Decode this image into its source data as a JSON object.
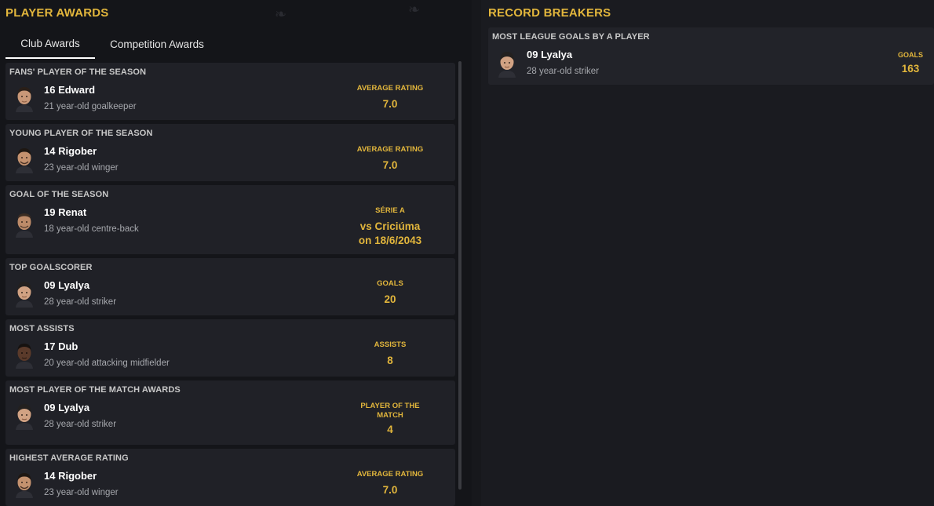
{
  "left": {
    "title": "PLAYER AWARDS",
    "tabs": [
      {
        "label": "Club Awards",
        "active": true
      },
      {
        "label": "Competition Awards",
        "active": false
      }
    ],
    "cards": [
      {
        "title": "FANS' PLAYER OF THE SEASON",
        "name": "16 Edward",
        "desc": "21 year-old goalkeeper",
        "stat_label": "AVERAGE RATING",
        "stat_value": "7.0"
      },
      {
        "title": "YOUNG PLAYER OF THE SEASON",
        "name": "14 Rigober",
        "desc": "23 year-old winger",
        "stat_label": "AVERAGE RATING",
        "stat_value": "7.0"
      },
      {
        "title": "GOAL OF THE SEASON",
        "name": "19 Renat",
        "desc": "18 year-old centre-back",
        "stat_label": "SÉRIE A",
        "stat_value": "vs Criciúma",
        "stat_value2": "on 18/6/2043"
      },
      {
        "title": "TOP GOALSCORER",
        "name": "09 Lyalya",
        "desc": "28 year-old striker",
        "stat_label": "GOALS",
        "stat_value": "20"
      },
      {
        "title": "MOST ASSISTS",
        "name": "17 Dub",
        "desc": "20 year-old attacking midfielder",
        "stat_label": "ASSISTS",
        "stat_value": "8"
      },
      {
        "title": "MOST PLAYER OF THE MATCH AWARDS",
        "name": "09 Lyalya",
        "desc": "28 year-old striker",
        "stat_label": "PLAYER OF THE MATCH",
        "stat_value": "4"
      },
      {
        "title": "HIGHEST AVERAGE RATING",
        "name": "14 Rigober",
        "desc": "23 year-old winger",
        "stat_label": "AVERAGE RATING",
        "stat_value": "7.0"
      }
    ]
  },
  "right": {
    "title": "RECORD BREAKERS",
    "record": {
      "title": "MOST LEAGUE GOALS BY A PLAYER",
      "name": "09 Lyalya",
      "desc": "28 year-old striker",
      "stat_label": "GOALS",
      "stat_value": "163"
    }
  },
  "colors": {
    "accent": "#e2b63c",
    "panel": "#141519",
    "card": "#202127"
  },
  "icons": {
    "avatar": "player-face-icon"
  }
}
